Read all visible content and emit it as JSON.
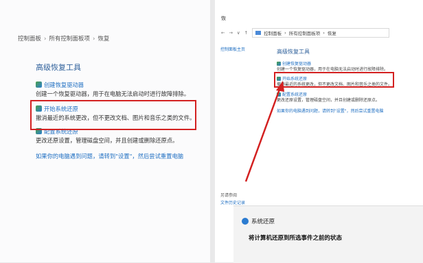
{
  "left_panel": {
    "breadcrumb": [
      "控制面板",
      "所有控制面板项",
      "恢复"
    ],
    "breadcrumb_sep": "›",
    "title": "高级恢复工具",
    "items": [
      {
        "label": "创建恢复驱动器",
        "desc": "创建一个恢复驱动器，用于在电脑无法启动时进行故障排除。"
      },
      {
        "label": "开始系统还原",
        "desc": "撤消最近的系统更改，但不更改文档、图片和音乐之类的文件。"
      },
      {
        "label": "配置系统还原",
        "desc": "更改还原设置，管理磁盘空间，并且创建或删除还原点。"
      }
    ],
    "bottom_link": "如果你的电脑遇到问题，请转到\"设置\"，然后尝试重置电脑"
  },
  "right_panel": {
    "window_title": "恢",
    "nav_buttons": [
      "←",
      "→",
      "∨",
      "↑"
    ],
    "address": [
      "控制面板",
      "所有控制面板项",
      "恢复"
    ],
    "home_link": "控制面板主页",
    "title": "高级恢复工具",
    "items": [
      {
        "label": "创建恢复驱动器",
        "desc": "创建一个恢复驱动器，用于在电脑无法启动时进行故障排除。"
      },
      {
        "label": "开始系统还原",
        "desc": "撤消最近的系统更改，但不更改文档、图片和音乐之类的文件。"
      },
      {
        "label": "配置系统还原",
        "desc": "更改还原设置，管理磁盘空间，并且创建或删除还原点。"
      }
    ],
    "bottom_link": "如果你的电脑遇到问题，请转到\"设置\"，然后尝试重置电脑",
    "see_also": "另请参阅",
    "see_also_item": "文件历史记录"
  },
  "system_restore_dialog": {
    "title": "系统还原",
    "heading": "将计算机还原到所选事件之前的状态"
  },
  "colors": {
    "highlight_red": "#d32020",
    "link_blue": "#1f6fc2"
  }
}
